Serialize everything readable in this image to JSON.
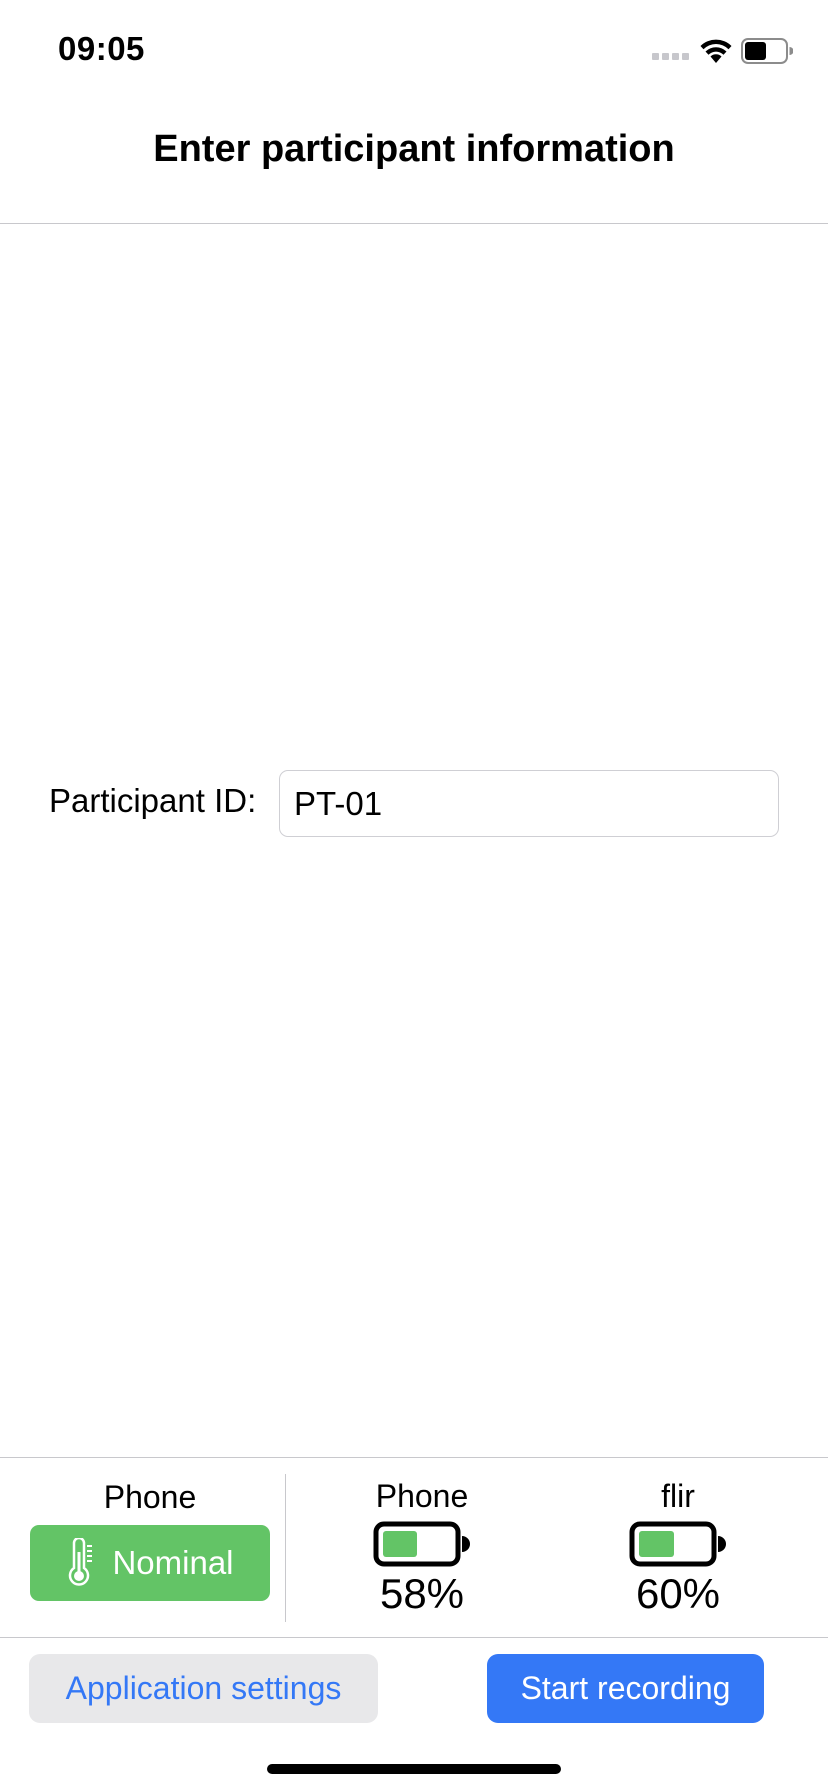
{
  "status_bar": {
    "time": "09:05",
    "icons": [
      "cellular-signal-icon",
      "wifi-icon",
      "battery-icon"
    ],
    "battery_level": 0.55
  },
  "nav": {
    "title": "Enter participant information"
  },
  "form": {
    "participant_label": "Participant ID:",
    "participant_value": "PT-01"
  },
  "device_panel": {
    "thermal": {
      "device": "Phone",
      "state": "Nominal",
      "icon": "thermometer-icon",
      "color": "#63c466"
    },
    "batteries": [
      {
        "device": "Phone",
        "percent_text": "58%",
        "level": 0.58
      },
      {
        "device": "flir",
        "percent_text": "60%",
        "level": 0.6
      }
    ],
    "battery_fill_color": "#63c466"
  },
  "actions": {
    "settings_label": "Application settings",
    "record_label": "Start recording",
    "accent_color": "#3478f6"
  }
}
